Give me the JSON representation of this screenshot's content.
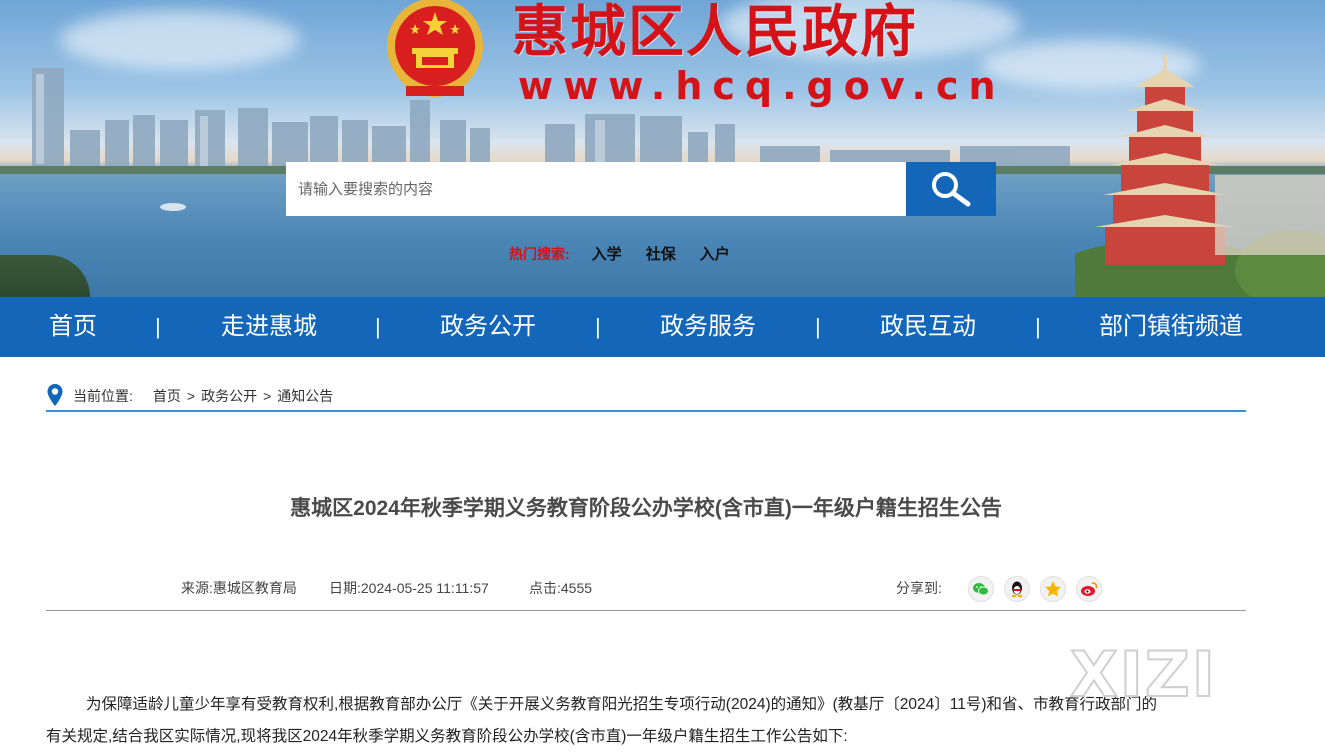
{
  "header": {
    "site_title": "惠城区人民政府",
    "site_url": "www.hcq.gov.cn",
    "search_placeholder": "请输入要搜索的内容",
    "hot_label": "热门搜索:",
    "hot_items": [
      "入学",
      "社保",
      "入户"
    ]
  },
  "nav": {
    "items": [
      "首页",
      "走进惠城",
      "政务公开",
      "政务服务",
      "政民互动",
      "部门镇街频道"
    ],
    "separator": "|"
  },
  "breadcrumb": {
    "label": "当前位置:",
    "items": [
      "首页",
      "政务公开",
      "通知公告"
    ],
    "separator": ">"
  },
  "article": {
    "title": "惠城区2024年秋季学期义务教育阶段公办学校(含市直)一年级户籍生招生公告",
    "source": "来源:惠城区教育局",
    "date": "日期:2024-05-25 11:11:57",
    "clicks": "点击:4555",
    "share_label": "分享到:",
    "paragraph_line1": "为保障适龄儿童少年享有受教育权利,根据教育部办公厅《关于开展义务教育阳光招生专项行动(2024)的通知》(教基厅〔2024〕11号)和省、市教育行政部门的",
    "paragraph_line2": "有关规定,结合我区实际情况,现将我区2024年秋季学期义务教育阶段公办学校(含市直)一年级户籍生招生工作公告如下:"
  },
  "watermark": "XIZI",
  "colors": {
    "brand_blue": "#1466b8",
    "title_red": "#d41217",
    "breadcrumb_line": "#3b8fd8"
  }
}
